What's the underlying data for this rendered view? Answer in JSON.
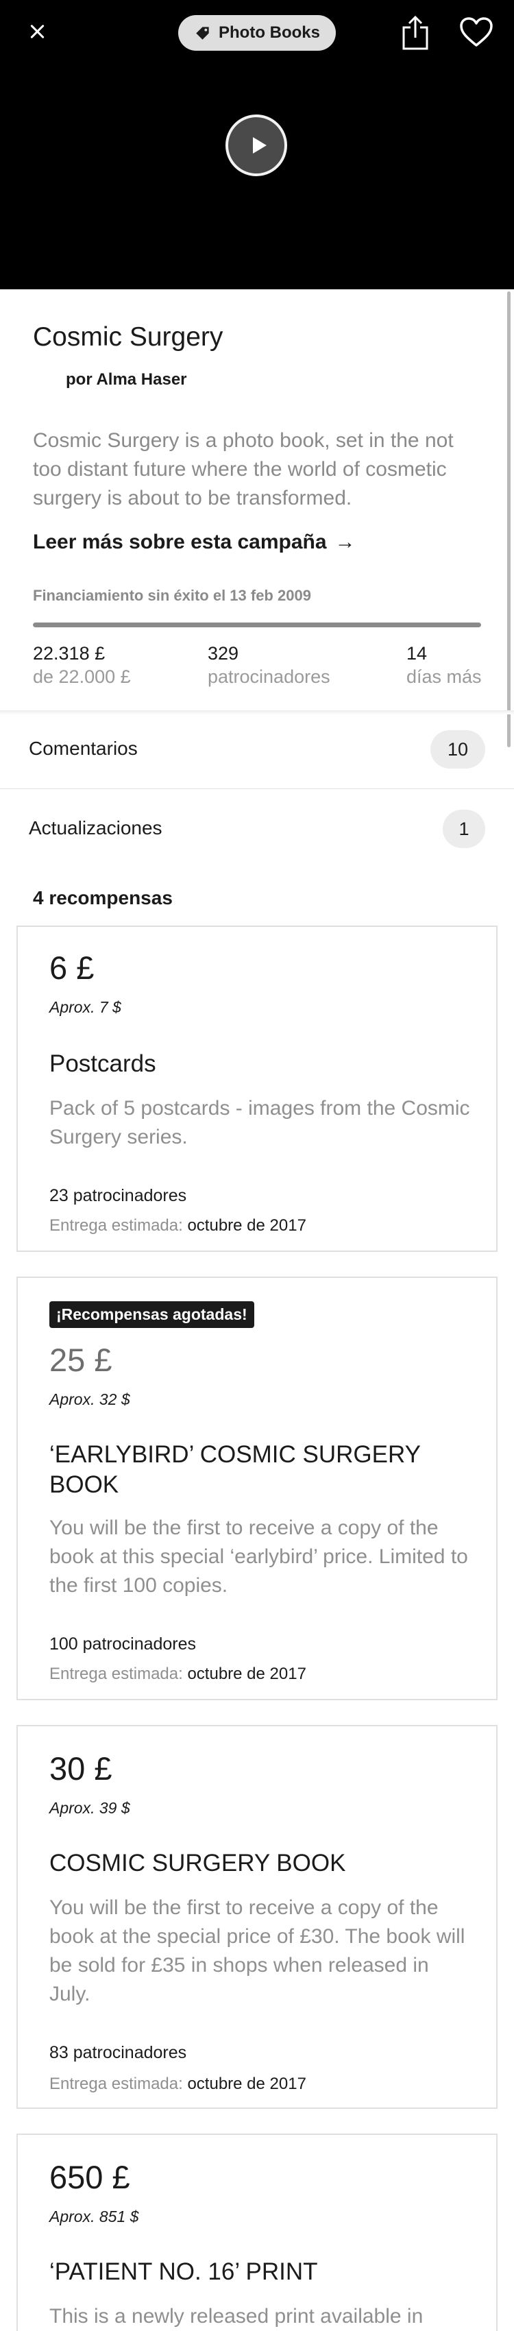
{
  "header": {
    "category_label": "Photo Books",
    "icons": {
      "close": "close-icon",
      "category": "tag-icon",
      "share": "share-icon",
      "favorite": "heart-icon",
      "play": "play-icon"
    }
  },
  "project": {
    "title": "Cosmic Surgery",
    "author": "por Alma Haser",
    "description": "Cosmic Surgery is a photo book, set in the not too distant future where the world of cosmetic surgery is about to be transformed.",
    "read_more": "Leer más sobre esta campaña",
    "read_more_arrow": "→",
    "funding_status": "Financiamiento sin éxito el 13 feb 2009",
    "progress_percent": 100,
    "pledged": "22.318 £",
    "goal": "de 22.000 £",
    "backers_count": "329",
    "backers_label": "patrocinadores",
    "days_count": "14",
    "days_label": "días más"
  },
  "comments": {
    "label": "Comentarios",
    "count": "10"
  },
  "updates": {
    "label": "Actualizaciones",
    "count": "1"
  },
  "rewards_count_label": "4 recompensas",
  "rewards": [
    {
      "price": "6 £",
      "approx": "Aprox. 7 $",
      "title": "Postcards",
      "description": "Pack of 5 postcards - images from the Cosmic Surgery series.",
      "backers": "23 patrocinadores",
      "delivery_label": "Entrega estimada:",
      "delivery_date": "octubre de 2017"
    },
    {
      "sold_out": "¡Recompensas agotadas!",
      "price": "25 £",
      "approx": "Aprox. 32 $",
      "title": "‘EARLYBIRD’ COSMIC SURGERY BOOK",
      "description": "You will be the first to receive a copy of the book at this special ‘earlybird’ price. Limited to the first 100 copies.",
      "backers": "100 patrocinadores",
      "delivery_label": "Entrega estimada:",
      "delivery_date": "octubre de 2017"
    },
    {
      "price": "30 £",
      "approx": "Aprox. 39 $",
      "title": "COSMIC SURGERY BOOK",
      "description": "You will be the first to receive a copy of the book at the special price of £30. The book will be sold for £35 in shops when released in July.",
      "backers": "83 patrocinadores",
      "delivery_label": "Entrega estimada:",
      "delivery_date": "octubre de 2017"
    },
    {
      "price": "650 £",
      "approx": "Aprox. 851 $",
      "title": "‘PATIENT NO. 16’ PRINT",
      "description": "This is a newly released print available in"
    }
  ]
}
